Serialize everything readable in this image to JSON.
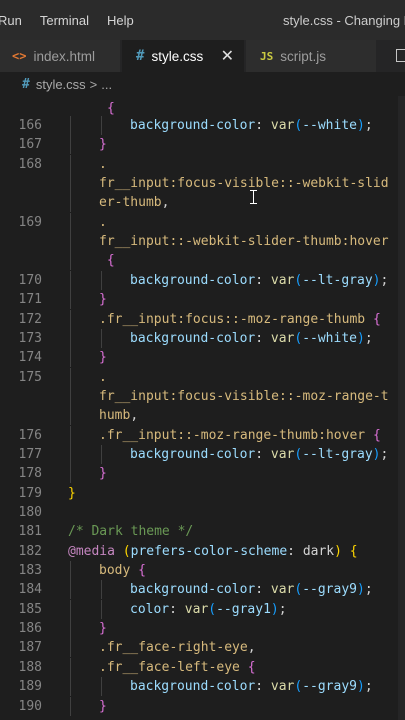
{
  "menu": {
    "items": [
      "Run",
      "Terminal",
      "Help"
    ]
  },
  "window_title": "style.css - Changing Fac",
  "tabs": [
    {
      "label": "index.html",
      "icon": "html-file-icon",
      "icon_glyph": "<>"
    },
    {
      "label": "style.css",
      "icon": "css-file-icon",
      "icon_glyph": "#",
      "active": true,
      "close": "✕"
    },
    {
      "label": "script.js",
      "icon": "js-file-icon",
      "icon_glyph": "JS"
    }
  ],
  "breadcrumb": {
    "icon_glyph": "#",
    "file": "style.css",
    "sep": ">",
    "rest": "..."
  },
  "code_lines": [
    {
      "n": "166",
      "indent": 2,
      "html": [
        [
          "prop",
          "background-color"
        ],
        [
          "punc",
          ": "
        ],
        [
          "fn",
          "var"
        ],
        [
          "brk2",
          "("
        ],
        [
          "var",
          "--white"
        ],
        [
          "brk2",
          ")"
        ],
        [
          "punc",
          ";"
        ]
      ]
    },
    {
      "n": "167",
      "indent": 1,
      "html": [
        [
          "brk1",
          "}"
        ]
      ]
    },
    {
      "n": "168",
      "indent": 1,
      "html": [
        [
          "sel",
          "."
        ]
      ]
    },
    {
      "n": "",
      "indent": 1,
      "html": [
        [
          "sel",
          "fr__input:focus-visible::-webkit-slid"
        ]
      ]
    },
    {
      "n": "",
      "indent": 1,
      "html": [
        [
          "sel",
          "er-thumb"
        ],
        [
          "punc",
          ","
        ]
      ]
    },
    {
      "n": "169",
      "indent": 1,
      "html": [
        [
          "sel",
          "."
        ]
      ]
    },
    {
      "n": "",
      "indent": 1,
      "html": [
        [
          "sel",
          "fr__input::-webkit-slider-thumb:hover"
        ]
      ]
    },
    {
      "n": "",
      "indent": 1,
      "html": [
        [
          "punc",
          " "
        ],
        [
          "brk1",
          "{"
        ]
      ]
    },
    {
      "n": "170",
      "indent": 2,
      "html": [
        [
          "prop",
          "background-color"
        ],
        [
          "punc",
          ": "
        ],
        [
          "fn",
          "var"
        ],
        [
          "brk2",
          "("
        ],
        [
          "var",
          "--lt-gray"
        ],
        [
          "brk2",
          ")"
        ],
        [
          "punc",
          ";"
        ]
      ]
    },
    {
      "n": "171",
      "indent": 1,
      "html": [
        [
          "brk1",
          "}"
        ]
      ]
    },
    {
      "n": "172",
      "indent": 1,
      "html": [
        [
          "sel",
          ".fr__input:focus::-moz-range-thumb "
        ],
        [
          "brk1",
          "{"
        ]
      ]
    },
    {
      "n": "173",
      "indent": 2,
      "html": [
        [
          "prop",
          "background-color"
        ],
        [
          "punc",
          ": "
        ],
        [
          "fn",
          "var"
        ],
        [
          "brk2",
          "("
        ],
        [
          "var",
          "--white"
        ],
        [
          "brk2",
          ")"
        ],
        [
          "punc",
          ";"
        ]
      ]
    },
    {
      "n": "174",
      "indent": 1,
      "html": [
        [
          "brk1",
          "}"
        ]
      ]
    },
    {
      "n": "175",
      "indent": 1,
      "html": [
        [
          "sel",
          "."
        ]
      ]
    },
    {
      "n": "",
      "indent": 1,
      "html": [
        [
          "sel",
          "fr__input:focus-visible::-moz-range-t"
        ]
      ]
    },
    {
      "n": "",
      "indent": 1,
      "html": [
        [
          "sel",
          "humb"
        ],
        [
          "punc",
          ","
        ]
      ]
    },
    {
      "n": "176",
      "indent": 1,
      "html": [
        [
          "sel",
          ".fr__input::-moz-range-thumb:hover "
        ],
        [
          "brk1",
          "{"
        ]
      ]
    },
    {
      "n": "177",
      "indent": 2,
      "html": [
        [
          "prop",
          "background-color"
        ],
        [
          "punc",
          ": "
        ],
        [
          "fn",
          "var"
        ],
        [
          "brk2",
          "("
        ],
        [
          "var",
          "--lt-gray"
        ],
        [
          "brk2",
          ")"
        ],
        [
          "punc",
          ";"
        ]
      ]
    },
    {
      "n": "178",
      "indent": 1,
      "html": [
        [
          "brk1",
          "}"
        ]
      ]
    },
    {
      "n": "179",
      "indent": 0,
      "html": [
        [
          "brk0",
          "}"
        ]
      ]
    },
    {
      "n": "180",
      "indent": 0,
      "html": []
    },
    {
      "n": "181",
      "indent": 0,
      "html": [
        [
          "comment",
          "/* Dark theme */"
        ]
      ]
    },
    {
      "n": "182",
      "indent": 0,
      "html": [
        [
          "kw",
          "@media"
        ],
        [
          "punc",
          " "
        ],
        [
          "brk0",
          "("
        ],
        [
          "prop",
          "prefers-color-scheme"
        ],
        [
          "punc",
          ": dark"
        ],
        [
          "brk0",
          ")"
        ],
        [
          "punc",
          " "
        ],
        [
          "brk0",
          "{"
        ]
      ]
    },
    {
      "n": "183",
      "indent": 1,
      "html": [
        [
          "sel",
          "body "
        ],
        [
          "brk1",
          "{"
        ]
      ]
    },
    {
      "n": "184",
      "indent": 2,
      "html": [
        [
          "prop",
          "background-color"
        ],
        [
          "punc",
          ": "
        ],
        [
          "fn",
          "var"
        ],
        [
          "brk2",
          "("
        ],
        [
          "var",
          "--gray9"
        ],
        [
          "brk2",
          ")"
        ],
        [
          "punc",
          ";"
        ]
      ]
    },
    {
      "n": "185",
      "indent": 2,
      "html": [
        [
          "prop",
          "color"
        ],
        [
          "punc",
          ": "
        ],
        [
          "fn",
          "var"
        ],
        [
          "brk2",
          "("
        ],
        [
          "var",
          "--gray1"
        ],
        [
          "brk2",
          ")"
        ],
        [
          "punc",
          ";"
        ]
      ]
    },
    {
      "n": "186",
      "indent": 1,
      "html": [
        [
          "brk1",
          "}"
        ]
      ]
    },
    {
      "n": "187",
      "indent": 1,
      "html": [
        [
          "sel",
          ".fr__face-right-eye"
        ],
        [
          "punc",
          ","
        ]
      ]
    },
    {
      "n": "188",
      "indent": 1,
      "html": [
        [
          "sel",
          ".fr__face-left-eye "
        ],
        [
          "brk1",
          "{"
        ]
      ]
    },
    {
      "n": "189",
      "indent": 2,
      "html": [
        [
          "prop",
          "background-color"
        ],
        [
          "punc",
          ": "
        ],
        [
          "fn",
          "var"
        ],
        [
          "brk2",
          "("
        ],
        [
          "var",
          "--gray9"
        ],
        [
          "brk2",
          ")"
        ],
        [
          "punc",
          ";"
        ]
      ]
    },
    {
      "n": "190",
      "indent": 1,
      "html": [
        [
          "brk1",
          "}"
        ]
      ]
    }
  ],
  "top_partial_line": [
    [
      "brk1",
      "{"
    ]
  ],
  "colors": {
    "selector": "#d7ba7d",
    "property": "#9cdcfe",
    "function": "#dcdcaa",
    "comment": "#6a9955",
    "keyword": "#c586c0"
  }
}
